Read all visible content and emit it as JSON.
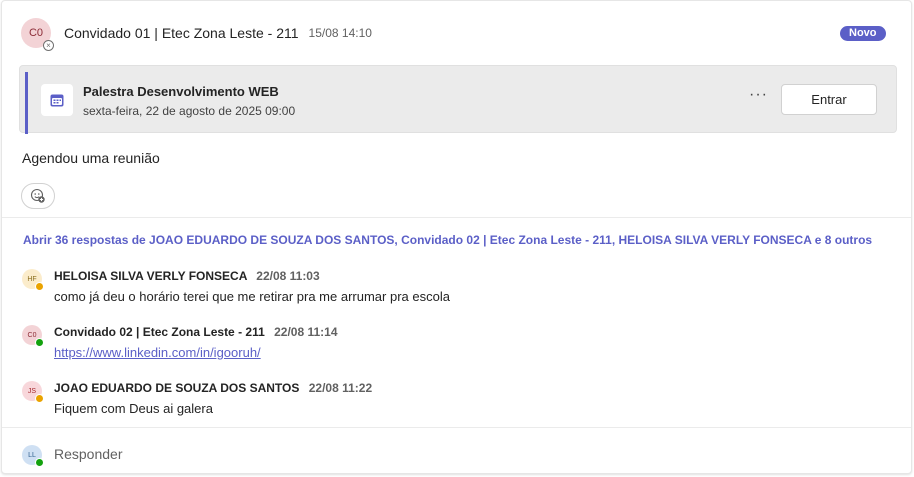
{
  "post": {
    "avatar_initials": "C0",
    "author": "Convidado 01 | Etec Zona Leste - 211",
    "time": "15/08 14:10",
    "badge": "Novo",
    "meeting": {
      "title": "Palestra Desenvolvimento WEB",
      "date": "sexta-feira, 22 de agosto de 2025 09:00",
      "more_label": "···",
      "join_label": "Entrar"
    },
    "body": "Agendou uma reunião"
  },
  "thread": {
    "open_replies": "Abrir 36 respostas de JOAO EDUARDO DE SOUZA DOS SANTOS, Convidado 02 | Etec Zona Leste - 211, HELOISA SILVA VERLY FONSECA e 8 outros",
    "replies": [
      {
        "initials": "HF",
        "author": "HELOISA SILVA VERLY FONSECA",
        "time": "22/08 11:03",
        "text": "como já deu o horário terei que me retirar pra me arrumar pra escola",
        "avatar_bg": "#fbeccb",
        "avatar_fg": "#8a6d1c",
        "presence_color": "#eaa300"
      },
      {
        "initials": "C0",
        "author": "Convidado 02 | Etec Zona Leste - 211",
        "time": "22/08 11:14",
        "text": "https://www.linkedin.com/in/igooruh/",
        "avatar_bg": "#f3d3d6",
        "avatar_fg": "#8c2b36",
        "presence_color": "#13a10e"
      },
      {
        "initials": "JS",
        "author": "JOAO EDUARDO DE SOUZA DOS SANTOS",
        "time": "22/08 11:22",
        "text": "Fiquem com Deus ai galera",
        "avatar_bg": "#f8d7db",
        "avatar_fg": "#a4262c",
        "presence_color": "#eaa300"
      }
    ],
    "respond": {
      "initials": "LL",
      "label": "Responder",
      "avatar_bg": "#cfe0f3",
      "presence_color": "#13a10e"
    }
  },
  "colors": {
    "brand": "#5b5fc7"
  },
  "icons": {
    "calendar": "calendar-icon",
    "reaction": "emoji-add-icon",
    "presence_offline": "presence-offline-icon"
  }
}
